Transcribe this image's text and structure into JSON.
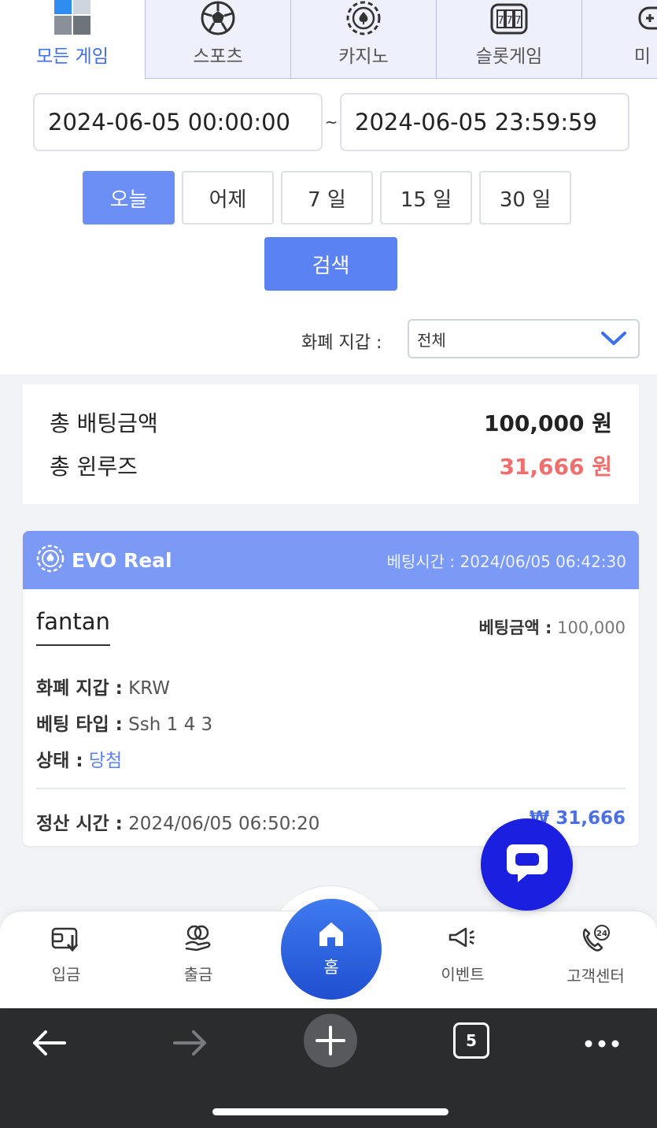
{
  "top_tabs": [
    {
      "label": "모든 게임",
      "icon": "all-games-icon",
      "active": true
    },
    {
      "label": "스포츠",
      "icon": "soccer-ball-icon"
    },
    {
      "label": "카지노",
      "icon": "casino-chip-icon"
    },
    {
      "label": "슬롯게임",
      "icon": "slot-machine-icon"
    },
    {
      "label": "미",
      "icon": "gamepad-icon"
    }
  ],
  "date_filter": {
    "start": "2024-06-05 00:00:00",
    "separator": "~",
    "end": "2024-06-05 23:59:59"
  },
  "quick_ranges": [
    "오늘",
    "어제",
    "7 일",
    "15 일",
    "30 일"
  ],
  "search_label": "검색",
  "wallet": {
    "label": "화폐 지갑 :",
    "selected": "전체"
  },
  "summary": {
    "total_bet_label": "총 배팅금액",
    "total_bet_value": "100,000 원",
    "total_winloss_label": "총 윈루즈",
    "total_winloss_value": "31,666 원"
  },
  "bet_record": {
    "provider": "EVO Real",
    "bet_time_label": "베팅시간 :",
    "bet_time": "2024/06/05 06:42:30",
    "game": "fantan",
    "bet_amount_label": "베팅금액 :",
    "bet_amount": "100,000",
    "currency_label": "화폐 지갑 :",
    "currency": "KRW",
    "bet_type_label": "베팅 타입 :",
    "bet_type": "Ssh 1 4 3",
    "status_label": "상태 :",
    "status": "당첨",
    "settle_label": "정산 시간 :",
    "settle_time": "2024/06/05 06:50:20",
    "payout": "₩ 31,666"
  },
  "bottom_nav": {
    "deposit": "입금",
    "withdraw": "출금",
    "home": "홈",
    "event": "이벤트",
    "support": "고객센터"
  },
  "browser": {
    "tab_count": "5"
  },
  "colors": {
    "accent": "#5b82f3",
    "header_blue": "#7b9af5",
    "loss_red": "#ef6f6f",
    "chat_blue": "#1a1fe0"
  }
}
